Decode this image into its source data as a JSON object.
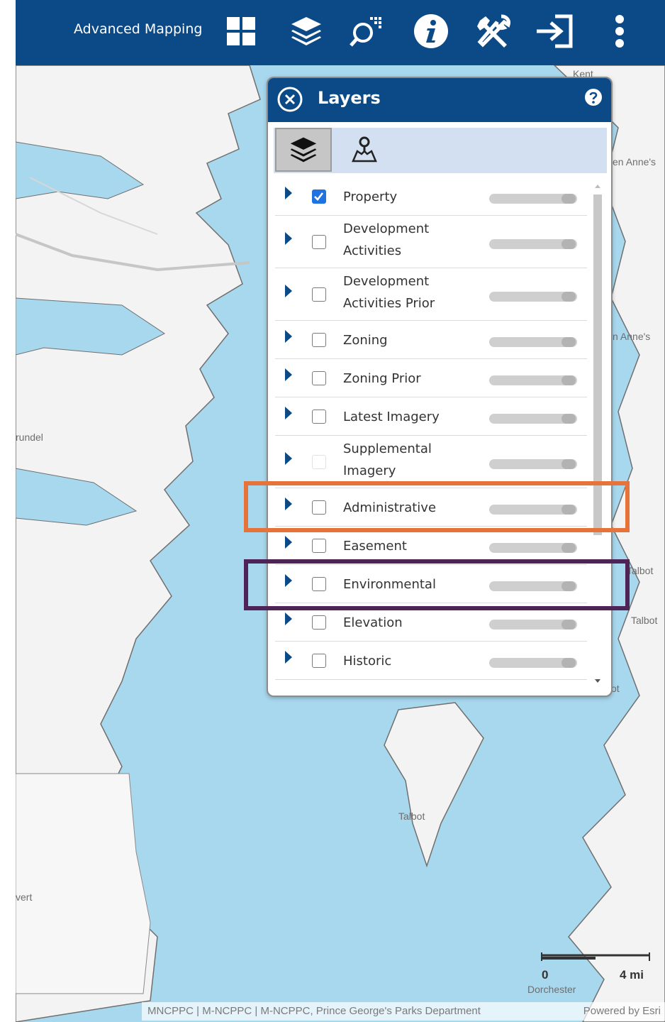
{
  "toolbar": {
    "title": "Advanced Mapping",
    "icons": [
      "basemap-grid-icon",
      "layers-stack-icon",
      "map-search-icon",
      "info-icon",
      "tools-icon",
      "sign-in-icon",
      "more-menu-icon"
    ]
  },
  "map": {
    "labels": {
      "kent": "Kent",
      "queen_annes_1": "en Anne's",
      "queen_annes_2": "n Anne's",
      "arundel": "rundel",
      "talbot_1": "Talbot",
      "talbot_2": "Talbot",
      "talbot_3": "ot",
      "talbot_4": "Talbot",
      "calvert": "vert",
      "dorchester": "Dorchester"
    },
    "colors": {
      "water": "#a8d8ee",
      "land": "#f3f3f3",
      "shore": "#6f6f6f"
    }
  },
  "panel": {
    "title": "Layers",
    "tabs": [
      "layers-tab",
      "locate-tab"
    ],
    "layers": [
      {
        "name": "Property",
        "checked": true
      },
      {
        "name": "Development Activities",
        "checked": false
      },
      {
        "name": "Development Activities Prior",
        "checked": false
      },
      {
        "name": "Zoning",
        "checked": false
      },
      {
        "name": "Zoning Prior",
        "checked": false
      },
      {
        "name": "Latest Imagery",
        "checked": false
      },
      {
        "name": "Supplemental Imagery",
        "checked": false
      },
      {
        "name": "Administrative",
        "checked": false
      },
      {
        "name": "Easement",
        "checked": false
      },
      {
        "name": "Environmental",
        "checked": false
      },
      {
        "name": "Elevation",
        "checked": false
      },
      {
        "name": "Historic",
        "checked": false
      }
    ]
  },
  "highlights": {
    "administrative": "#e6743a",
    "environmental": "#4e2457"
  },
  "scalebar": {
    "start": "0",
    "end": "4 mi"
  },
  "attribution": {
    "credit": "MNCPPC | M-NCPPC | M-NCPPC, Prince George's Parks Department",
    "powered": "Powered by Esri"
  }
}
